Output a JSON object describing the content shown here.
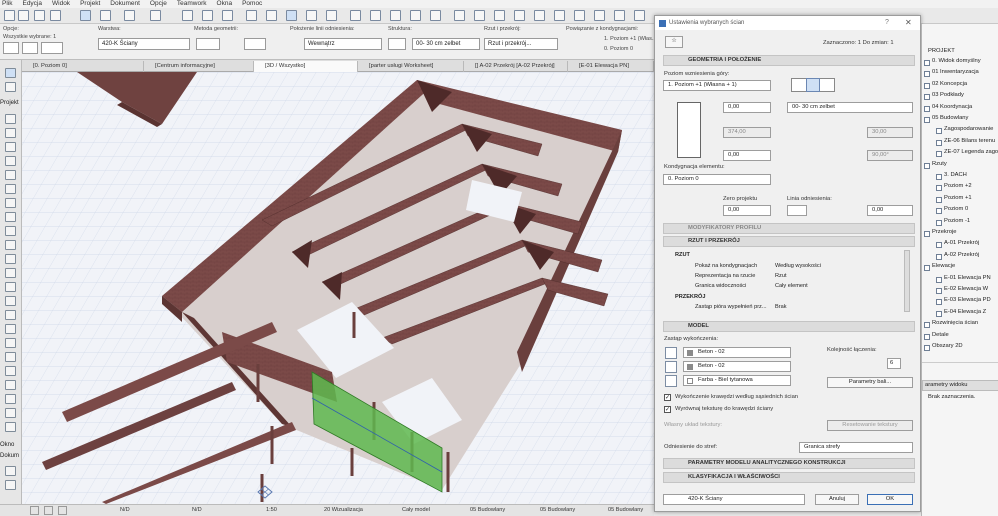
{
  "menu": [
    "Plik",
    "Edycja",
    "Widok",
    "Projekt",
    "Dokument",
    "Opcje",
    "Teamwork",
    "Okna",
    "Pomoc"
  ],
  "infobox": {
    "opcje_label": "Opcje:",
    "selected": "Wszystkie wybrane: 1",
    "warstwa_label": "Warstwa:",
    "warstwa_value": "420-K Ściany",
    "metoda_label": "Metoda geometrii:",
    "polozenie_label": "Położenie linii odniesienia:",
    "polozenie_value": "Wewnątrz",
    "struktura_label": "Struktura:",
    "struktura_value": "00- 30 cm zelbet",
    "rzut_label": "Rzut i przekrój:",
    "rzut_value": "Rzut i przekrój...",
    "powiazanie_label": "Powiązanie z kondygnacjami:",
    "pow1": "1. Poziom +1 (Włas...",
    "pow2": "0. Poziom 0"
  },
  "tabs": [
    "[0. Poziom 0]",
    "[Centrum informacyjne]",
    "[3D / Wszystko]",
    "[parter usługi Worksheet]",
    "[] A-02 Przekrój [A-02 Przekrój]",
    "[E-01 Elewacja PN]"
  ],
  "left_labels": {
    "projekt": "Projekt",
    "okno": "Okno",
    "dokument": "Dokum"
  },
  "status": {
    "nd1": "N/D",
    "nd2": "N/D",
    "scale": "1:50",
    "view": "20 Wizualizacja",
    "model": "Cały model",
    "layer1": "05 Budowlany",
    "layer2": "05 Budowlany",
    "layer3": "05 Budowlany"
  },
  "dialog": {
    "title": "Ustawienia wybranych ścian",
    "selected_info": "Zaznaczono: 1 Do zmian: 1",
    "sec_geometry": "GEOMETRIA I POŁOŻENIE",
    "top_level_label": "Poziom wzniesienia góry:",
    "top_level_value": "1. Poziom +1 (Własna + 1)",
    "val_top": "0,00",
    "val_height": "374,00",
    "val_bottom": "0,00",
    "structure": "00- 30 cm zelbet",
    "thickness": "30,00",
    "angle": "90,00°",
    "home_level_label": "Kondygnacja elementu:",
    "home_level_value": "0. Poziom 0",
    "zero_label": "Zero projektu",
    "zero_value": "0,00",
    "ref_line_label": "Linia odniesienia:",
    "ref_value": "0,00",
    "sec_modifiers": "MODYFIKATORY PROFILU",
    "sec_plan": "RZUT I PRZEKRÓJ",
    "plan_group": "RZUT",
    "plan_rows": [
      {
        "name": "Pokaż na kondygnacjach",
        "value": "Według wysokości"
      },
      {
        "name": "Reprezentacja na rzucie",
        "value": "Rzut"
      },
      {
        "name": "Granica widoczności",
        "value": "Cały element"
      }
    ],
    "section_group": "PRZEKRÓJ",
    "section_rows": [
      {
        "name": "Zastąp pióra wypełnień prz...",
        "value": "Brak"
      }
    ],
    "sec_model": "MODEL",
    "override_label": "Zastąp wykończenia:",
    "surfaces": [
      "Beton - 02",
      "Beton - 02",
      "Farba - Biel tytanowa"
    ],
    "order_label": "Kolejność łączenia:",
    "order_value": "6",
    "params_btn": "Parametry bali...",
    "chk1": "Wykończenie krawędzi według sąsiednich ścian",
    "chk2": "Wyrównaj teksturę do krawędzi ściany",
    "texture_label": "Własny układ tekstury:",
    "reset_btn": "Resetowanie tekstury",
    "zone_label": "Odniesienie do stref:",
    "zone_value": "Granica strefy",
    "sec_analytic": "PARAMETRY MODELU ANALITYCZNEGO KONSTRUKCJI",
    "sec_class": "KLASYFIKACJA I WŁAŚCIWOŚCI",
    "layer_value": "420-K Ściany",
    "cancel": "Anuluj",
    "ok": "OK"
  },
  "tree": {
    "root": "PROJEKT",
    "items": [
      "0. Widok domyślny",
      "01 Inwentaryzacja",
      "02 Koncepcja",
      "03 Podkłady",
      "04 Koordynacja",
      "05 Budowlany",
      "Zagospodarowanie",
      "ZE-06 Bilans terenu",
      "ZE-07 Legenda zago",
      "Rzuty",
      "3. DACH",
      "Poziom +2",
      "Poziom +1",
      "Poziom 0",
      "Poziom -1",
      "Przekroje",
      "A-01 Przekrój",
      "A-02 Przekrój",
      "Elewacje",
      "E-01 Elewacja PN",
      "E-02 Elewacja W",
      "E-03 Elewacja PD",
      "E-04 Elewacja Z",
      "Rozwinięcia ścian",
      "Detale",
      "Obszary 2D"
    ],
    "panel_title": "arametry widoku",
    "panel_text": "Brak zaznaczenia."
  }
}
